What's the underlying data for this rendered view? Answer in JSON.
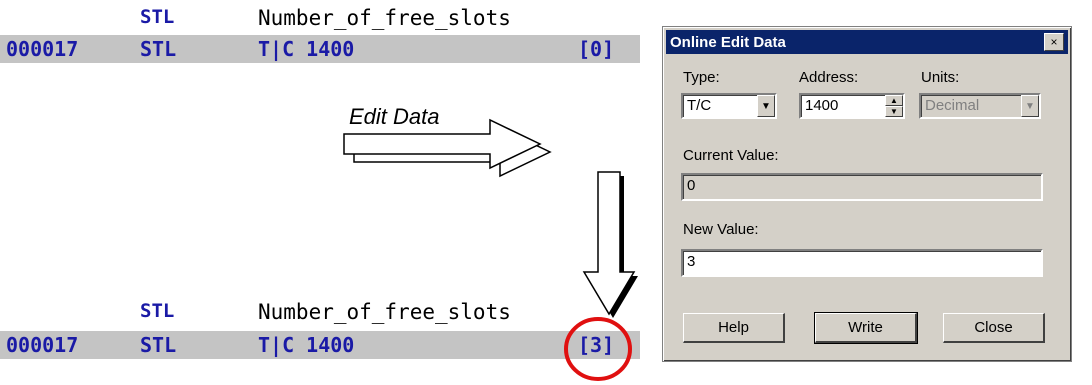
{
  "ladder_top": {
    "label_stl": "STL",
    "tag_name": "Number_of_free_slots",
    "address": "000017",
    "instr": "STL",
    "operand": "T|C 1400",
    "value": "[0]"
  },
  "ladder_bottom": {
    "label_stl": "STL",
    "tag_name": "Number_of_free_slots",
    "address": "000017",
    "instr": "STL",
    "operand": "T|C 1400",
    "value": "[3]"
  },
  "annotation": {
    "edit_data_label": "Edit Data"
  },
  "dialog": {
    "title": "Online Edit Data",
    "close_glyph": "×",
    "type_label": "Type:",
    "type_value": "T/C",
    "address_label": "Address:",
    "address_value": "1400",
    "units_label": "Units:",
    "units_value": "Decimal",
    "current_value_label": "Current Value:",
    "current_value": "0",
    "new_value_label": "New Value:",
    "new_value": "3",
    "help_button": "Help",
    "write_button": "Write",
    "close_button": "Close"
  },
  "colors": {
    "ladder_blue": "#1a1aa6",
    "title_bar": "#0a246a",
    "highlight_circle": "#e01010"
  }
}
